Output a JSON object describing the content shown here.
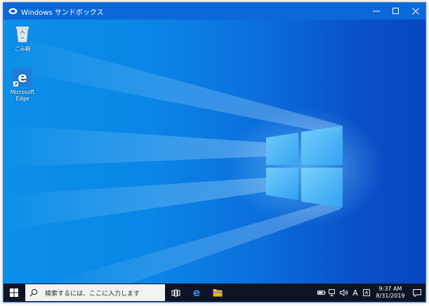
{
  "window": {
    "title": "Windows サンドボックス",
    "controls": {
      "minimize": "—",
      "maximize": "☐",
      "close": "✕"
    }
  },
  "desktop": {
    "icons": [
      {
        "name": "recycle-bin",
        "label": "ごみ箱"
      },
      {
        "name": "microsoft-edge",
        "label": "Microsoft Edge"
      }
    ]
  },
  "taskbar": {
    "search_placeholder": "検索するには、ここに入力します",
    "apps": [
      "task-view-icon",
      "edge-icon",
      "file-explorer-icon"
    ],
    "tray": {
      "ime": "A",
      "time": "9:37 AM",
      "date": "8/31/2019"
    }
  },
  "colors": {
    "accent": "#0b68d8",
    "taskbar": "#0d1524",
    "desktop_light": "#0b8fe8",
    "desktop_dark": "#0846bf"
  }
}
